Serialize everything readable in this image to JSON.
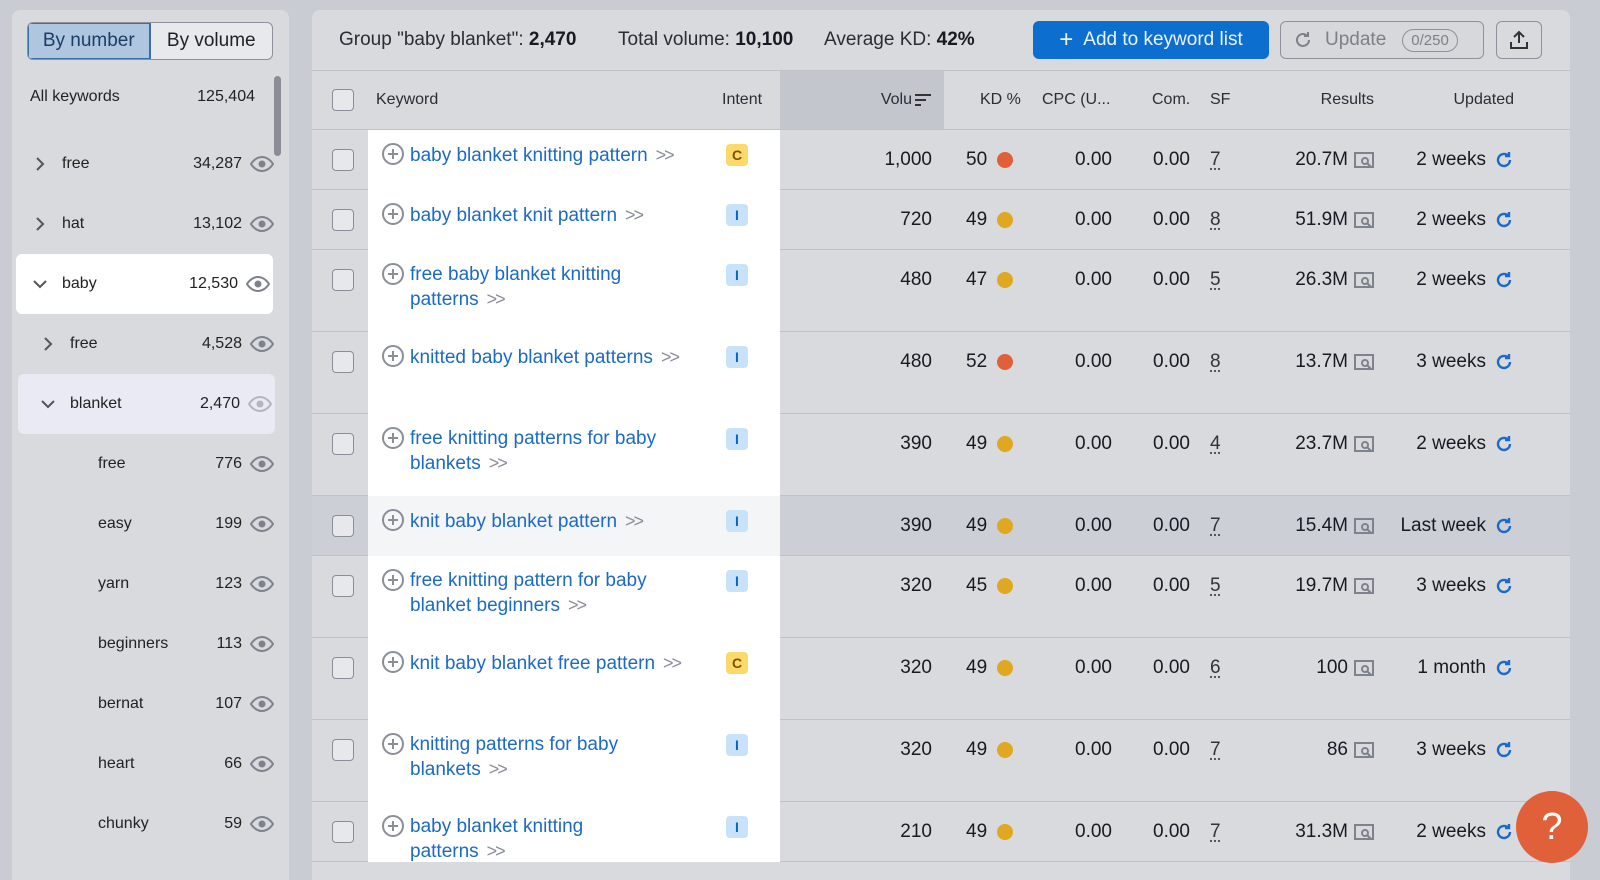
{
  "sidebar": {
    "toggle": {
      "by_number": "By number",
      "by_volume": "By volume"
    },
    "all": {
      "label": "All keywords",
      "count": "125,404"
    },
    "items": [
      {
        "label": "free",
        "count": "34,287",
        "chevron": ">"
      },
      {
        "label": "hat",
        "count": "13,102",
        "chevron": ">"
      },
      {
        "label": "baby",
        "count": "12,530",
        "chevron": "v"
      },
      {
        "label": "free",
        "count": "4,528",
        "chevron": ">"
      },
      {
        "label": "blanket",
        "count": "2,470",
        "chevron": "v"
      },
      {
        "label": "free",
        "count": "776",
        "chevron": ""
      },
      {
        "label": "easy",
        "count": "199",
        "chevron": ""
      },
      {
        "label": "yarn",
        "count": "123",
        "chevron": ""
      },
      {
        "label": "beginners",
        "count": "113",
        "chevron": ""
      },
      {
        "label": "bernat",
        "count": "107",
        "chevron": ""
      },
      {
        "label": "heart",
        "count": "66",
        "chevron": ""
      },
      {
        "label": "chunky",
        "count": "59",
        "chevron": ""
      }
    ]
  },
  "summary": {
    "group_label": "Group \"baby blanket\":",
    "group_value": "2,470",
    "volume_label": "Total volume:",
    "volume_value": "10,100",
    "kd_label": "Average KD:",
    "kd_value": "42%"
  },
  "toolbar": {
    "add_label": "Add to keyword list",
    "update_label": "Update",
    "update_count": "0/250"
  },
  "columns": {
    "keyword": "Keyword",
    "intent": "Intent",
    "volume": "Volu",
    "kd": "KD %",
    "cpc": "CPC (U...",
    "com": "Com.",
    "sf": "SF",
    "results": "Results",
    "updated": "Updated"
  },
  "rows": [
    {
      "kw": "baby blanket knitting pattern",
      "intent": "C",
      "volume": "1,000",
      "kd": "50",
      "kd_color": "#e0603a",
      "cpc": "0.00",
      "com": "0.00",
      "sf": "7",
      "results": "20.7M",
      "updated": "2 weeks"
    },
    {
      "kw": "baby blanket knit pattern",
      "intent": "I",
      "volume": "720",
      "kd": "49",
      "kd_color": "#e0a820",
      "cpc": "0.00",
      "com": "0.00",
      "sf": "8",
      "results": "51.9M",
      "updated": "2 weeks"
    },
    {
      "kw": "free baby blanket knitting patterns",
      "intent": "I",
      "volume": "480",
      "kd": "47",
      "kd_color": "#e0a820",
      "cpc": "0.00",
      "com": "0.00",
      "sf": "5",
      "results": "26.3M",
      "updated": "2 weeks"
    },
    {
      "kw": "knitted baby blanket patterns",
      "intent": "I",
      "volume": "480",
      "kd": "52",
      "kd_color": "#e0603a",
      "cpc": "0.00",
      "com": "0.00",
      "sf": "8",
      "results": "13.7M",
      "updated": "3 weeks"
    },
    {
      "kw": "free knitting patterns for baby blankets",
      "intent": "I",
      "volume": "390",
      "kd": "49",
      "kd_color": "#e0a820",
      "cpc": "0.00",
      "com": "0.00",
      "sf": "4",
      "results": "23.7M",
      "updated": "2 weeks"
    },
    {
      "kw": "knit baby blanket pattern",
      "intent": "I",
      "volume": "390",
      "kd": "49",
      "kd_color": "#e0a820",
      "cpc": "0.00",
      "com": "0.00",
      "sf": "7",
      "results": "15.4M",
      "updated": "Last week"
    },
    {
      "kw": "free knitting pattern for baby blanket beginners",
      "intent": "I",
      "volume": "320",
      "kd": "45",
      "kd_color": "#e0a820",
      "cpc": "0.00",
      "com": "0.00",
      "sf": "5",
      "results": "19.7M",
      "updated": "3 weeks"
    },
    {
      "kw": "knit baby blanket free pattern",
      "intent": "C",
      "volume": "320",
      "kd": "49",
      "kd_color": "#e0a820",
      "cpc": "0.00",
      "com": "0.00",
      "sf": "6",
      "results": "100",
      "updated": "1 month"
    },
    {
      "kw": "knitting patterns for baby blankets",
      "intent": "I",
      "volume": "320",
      "kd": "49",
      "kd_color": "#e0a820",
      "cpc": "0.00",
      "com": "0.00",
      "sf": "7",
      "results": "86",
      "updated": "3 weeks"
    },
    {
      "kw": "baby blanket knitting patterns",
      "intent": "I",
      "volume": "210",
      "kd": "49",
      "kd_color": "#e0a820",
      "cpc": "0.00",
      "com": "0.00",
      "sf": "7",
      "results": "31.3M",
      "updated": "2 weeks"
    }
  ],
  "help": {
    "label": "?"
  },
  "colors": {
    "accent": "#0c6fd0",
    "link": "#1b6ac9",
    "help": "#e0603a"
  }
}
